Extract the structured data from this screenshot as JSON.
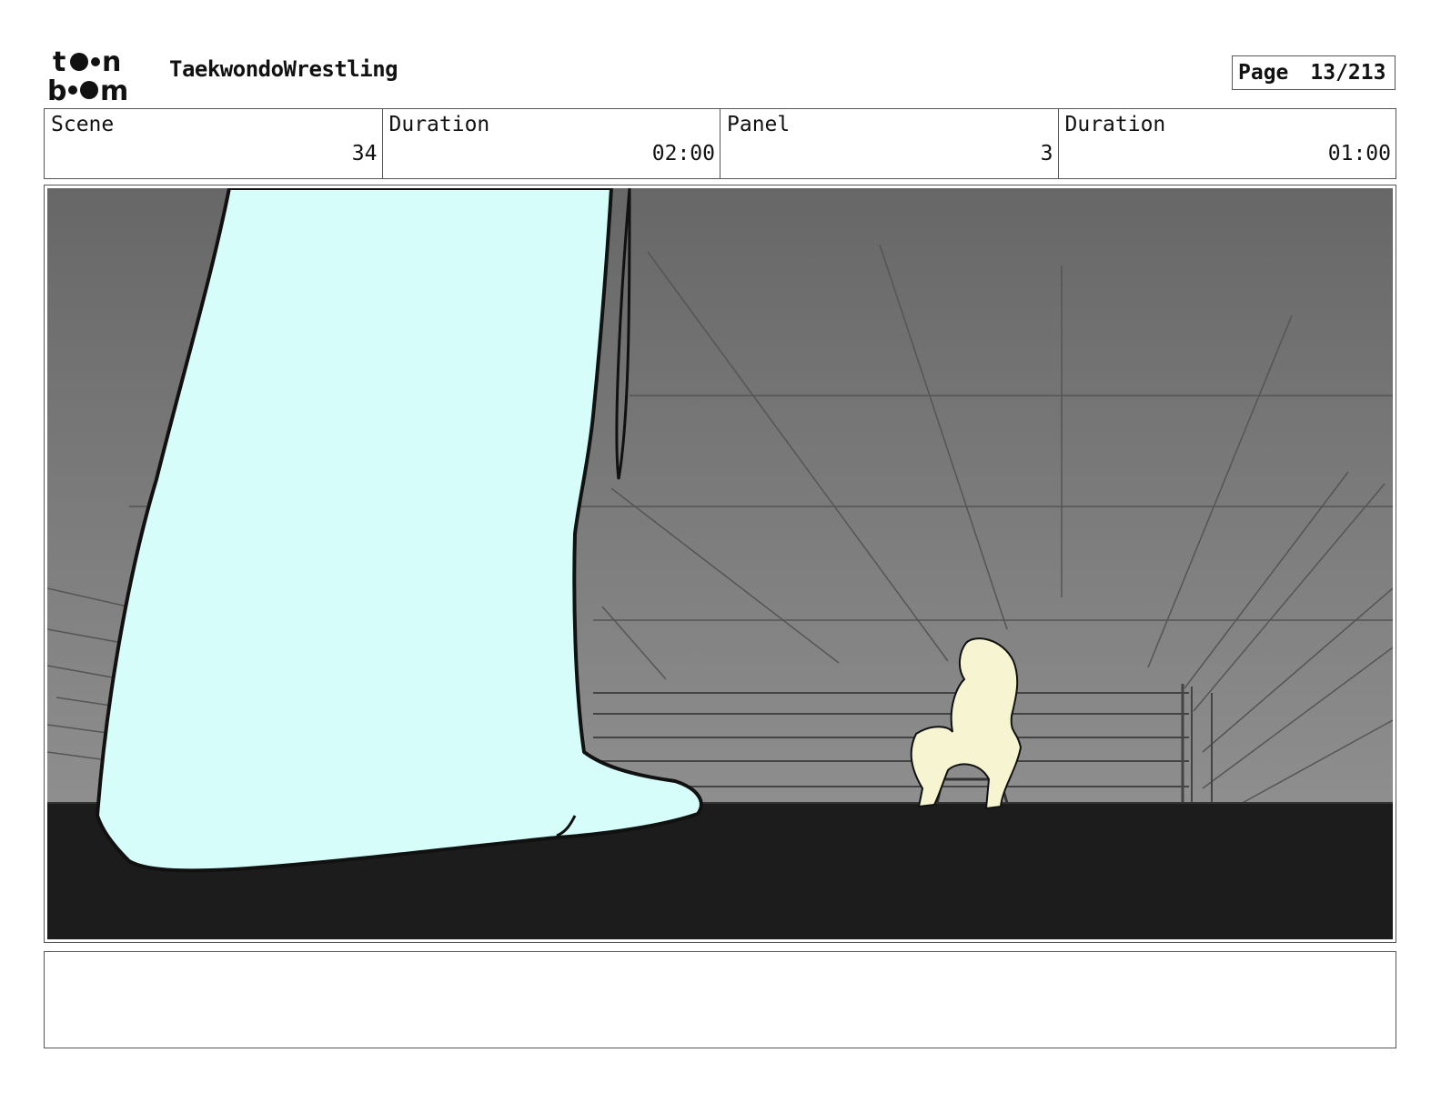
{
  "header": {
    "logo": {
      "line1": "toon",
      "line2": "boom"
    },
    "project_title": "TaekwondoWrestling",
    "page": {
      "label": "Page",
      "value": "13/213"
    }
  },
  "info": {
    "scene": {
      "label": "Scene",
      "value": "34"
    },
    "scene_duration": {
      "label": "Duration",
      "value": "02:00"
    },
    "panel": {
      "label": "Panel",
      "value": "3"
    },
    "panel_duration": {
      "label": "Duration",
      "value": "01:00"
    }
  },
  "panel": {
    "colors": {
      "sky_top": "#676767",
      "sky_bottom": "#8f8f8f",
      "floor": "#1c1c1c",
      "foreground_leg": "#d6fdfa",
      "seated_figure": "#f7f4d2",
      "lines": "#4a4a4a"
    }
  },
  "notes": {
    "text": ""
  }
}
